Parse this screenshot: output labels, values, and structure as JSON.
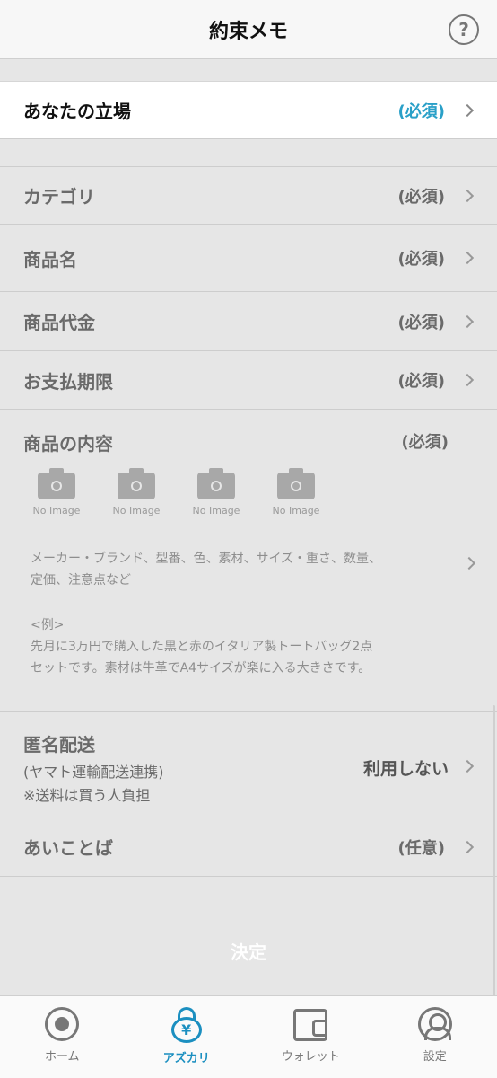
{
  "header": {
    "title": "約束メモ",
    "help_label": "?"
  },
  "position_row": {
    "label": "あなたの立場",
    "requirement": "(必須)"
  },
  "fields": [
    {
      "label": "カテゴリ",
      "requirement": "(必須)"
    },
    {
      "label": "商品名",
      "requirement": "(必須)"
    },
    {
      "label": "商品代金",
      "requirement": "(必須)"
    },
    {
      "label": "お支払期限",
      "requirement": "(必須)"
    }
  ],
  "content": {
    "label": "商品の内容",
    "requirement": "(必須)",
    "photos": [
      "No Image",
      "No Image",
      "No Image",
      "No Image"
    ],
    "hint_line1": "メーカー・ブランド、型番、色、素材、サイズ・重さ、数量、",
    "hint_line2": "定価、注意点など",
    "example_label": "<例>",
    "example_line1": "先月に3万円で購入した黒と赤のイタリア製トートバッグ2点",
    "example_line2": "セットです。素材は牛革でA4サイズが楽に入る大きさです。"
  },
  "anonymous_shipping": {
    "label": "匿名配送",
    "sub1": "(ヤマト運輸配送連携)",
    "sub2": "※送料は買う人負担",
    "value": "利用しない"
  },
  "passphrase": {
    "label": "あいことば",
    "requirement": "(任意)"
  },
  "submit_label": "決定",
  "tabs": [
    {
      "label": "ホーム",
      "icon": "home-icon"
    },
    {
      "label": "アズカリ",
      "icon": "azukari-lock-icon"
    },
    {
      "label": "ウォレット",
      "icon": "wallet-icon"
    },
    {
      "label": "設定",
      "icon": "settings-icon"
    }
  ],
  "colors": {
    "accent": "#1b8fc0",
    "required_highlight": "#2aa0c8",
    "background": "#e6e6e6"
  }
}
